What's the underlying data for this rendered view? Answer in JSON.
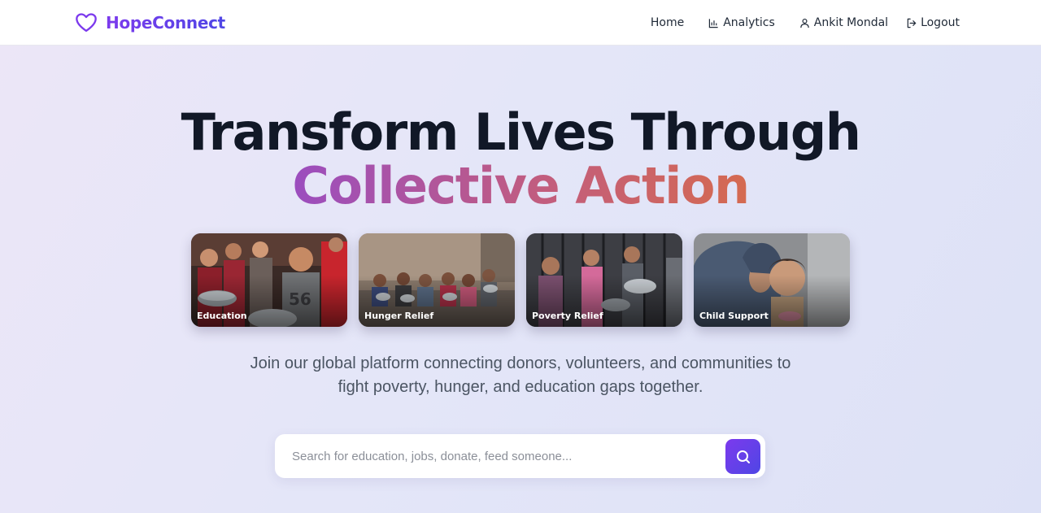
{
  "brand": {
    "name": "HopeConnect",
    "icon": "heart-icon"
  },
  "nav": {
    "home": "Home",
    "analytics": "Analytics",
    "user": "Ankit Mondal",
    "logout": "Logout"
  },
  "hero": {
    "title_line1": "Transform Lives Through",
    "title_line2": "Collective Action",
    "subtitle": "Join our global platform connecting donors, volunteers, and communities to fight poverty, hunger, and education gaps together."
  },
  "cards": [
    {
      "label": "Education"
    },
    {
      "label": "Hunger Relief"
    },
    {
      "label": "Poverty Relief"
    },
    {
      "label": "Child Support"
    }
  ],
  "search": {
    "placeholder": "Search for education, jobs, donate, feed someone...",
    "value": ""
  },
  "colors": {
    "accent": "#6d3ae6",
    "gradient_start": "#9b4dbf",
    "gradient_end": "#d56a50"
  }
}
